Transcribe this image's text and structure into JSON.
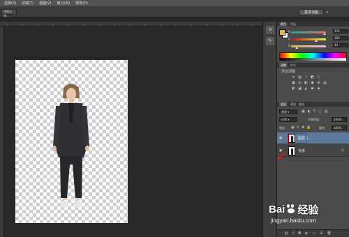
{
  "menubar": {
    "items": [
      "选择(S)",
      "滤镜(T)",
      "视图(V)",
      "窗口(W)",
      "帮助(H)"
    ]
  },
  "optionbar": {
    "tool_preset": "调整边缘...",
    "workspace": "基本功能"
  },
  "color_panel": {
    "tabs": [
      "颜色",
      "色板"
    ],
    "channels": [
      {
        "label": "R",
        "value": "239",
        "gradient": "linear-gradient(90deg,#00b4a8,#ff6a50)"
      },
      {
        "label": "G",
        "value": "180",
        "gradient": "linear-gradient(90deg,#ef0000,#f0ff00)"
      },
      {
        "label": "B",
        "value": "40",
        "gradient": "linear-gradient(90deg,#f0b400,#f0b4ff)"
      }
    ],
    "foreground_color": "#efb428",
    "background_color": "#ffffff"
  },
  "adjustments_panel": {
    "tabs": [
      "调整",
      "样式"
    ],
    "hint": "添加调整",
    "icons": [
      "brightness-icon",
      "levels-icon",
      "curves-icon",
      "exposure-icon",
      "vibrance-icon",
      "hue-icon",
      "color-balance-icon",
      "bw-icon",
      "photo-filter-icon",
      "channel-mixer-icon",
      "color-lookup-icon",
      "invert-icon",
      "posterize-icon",
      "threshold-icon",
      "gradient-map-icon",
      "selective-color-icon"
    ]
  },
  "layers_panel": {
    "tabs": [
      "图层",
      "通道",
      "路径"
    ],
    "filter_kind": "类型",
    "blend_mode": "正常",
    "opacity_label": "不透明度:",
    "opacity_value": "100%",
    "lock_label": "锁定:",
    "fill_label": "填充:",
    "fill_value": "100%",
    "layers": [
      {
        "name": "图层 1",
        "selected": true
      },
      {
        "name": "背景",
        "selected": false
      }
    ]
  },
  "watermark": {
    "brand": "Bai",
    "brand2": "经验",
    "url": "jingyan.baidu.com"
  }
}
